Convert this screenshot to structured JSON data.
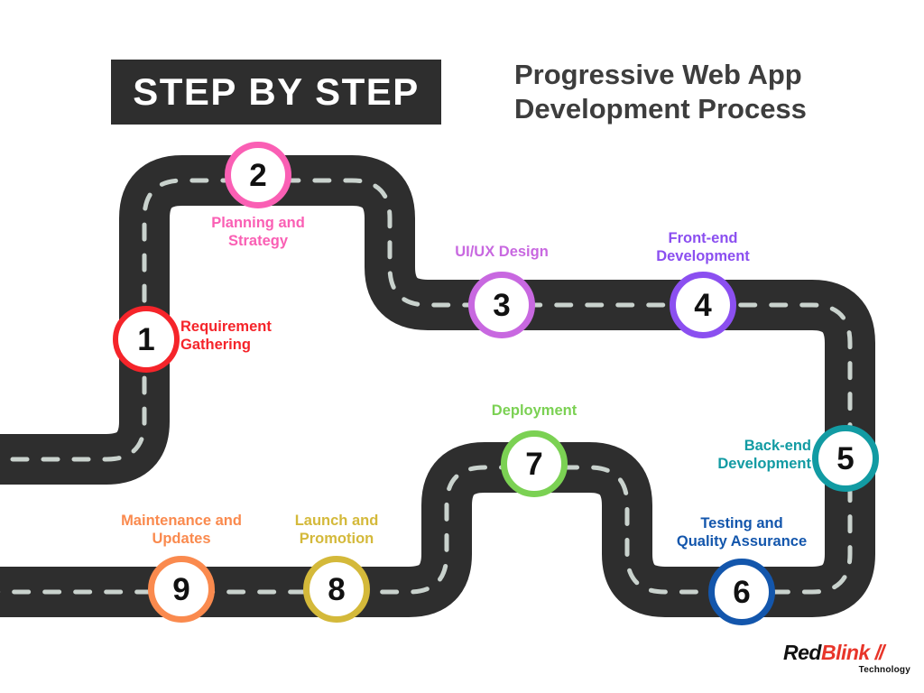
{
  "badge": {
    "label": "STEP BY STEP"
  },
  "header": {
    "title_line1": "Progressive Web App",
    "title_line2": "Development Process"
  },
  "colors": {
    "road": "#2e2e2e",
    "road_dash": "#c9d2cd",
    "background": "#ffffff",
    "badge_bg": "#2e2e2e",
    "badge_text": "#ffffff",
    "title_text": "#3d3d3d",
    "number_text": "#111111"
  },
  "steps": [
    {
      "number": "1",
      "label": "Requirement\nGathering",
      "color": "#f5242a"
    },
    {
      "number": "2",
      "label": "Planning and\nStrategy",
      "color": "#fa5fb4"
    },
    {
      "number": "3",
      "label": "UI/UX Design",
      "color": "#c868e0"
    },
    {
      "number": "4",
      "label": "Front-end\nDevelopment",
      "color": "#8b4ff0"
    },
    {
      "number": "5",
      "label": "Back-end\nDevelopment",
      "color": "#129ba3"
    },
    {
      "number": "6",
      "label": "Testing and\nQuality Assurance",
      "color": "#1356ac"
    },
    {
      "number": "7",
      "label": "Deployment",
      "color": "#7bd153"
    },
    {
      "number": "8",
      "label": "Launch and\nPromotion",
      "color": "#d4b93a"
    },
    {
      "number": "9",
      "label": "Maintenance and\nUpdates",
      "color": "#fa8a4e"
    }
  ],
  "logo": {
    "part1": "Red",
    "part2": "Blink",
    "slashes": "//",
    "subtitle": "Technology"
  }
}
